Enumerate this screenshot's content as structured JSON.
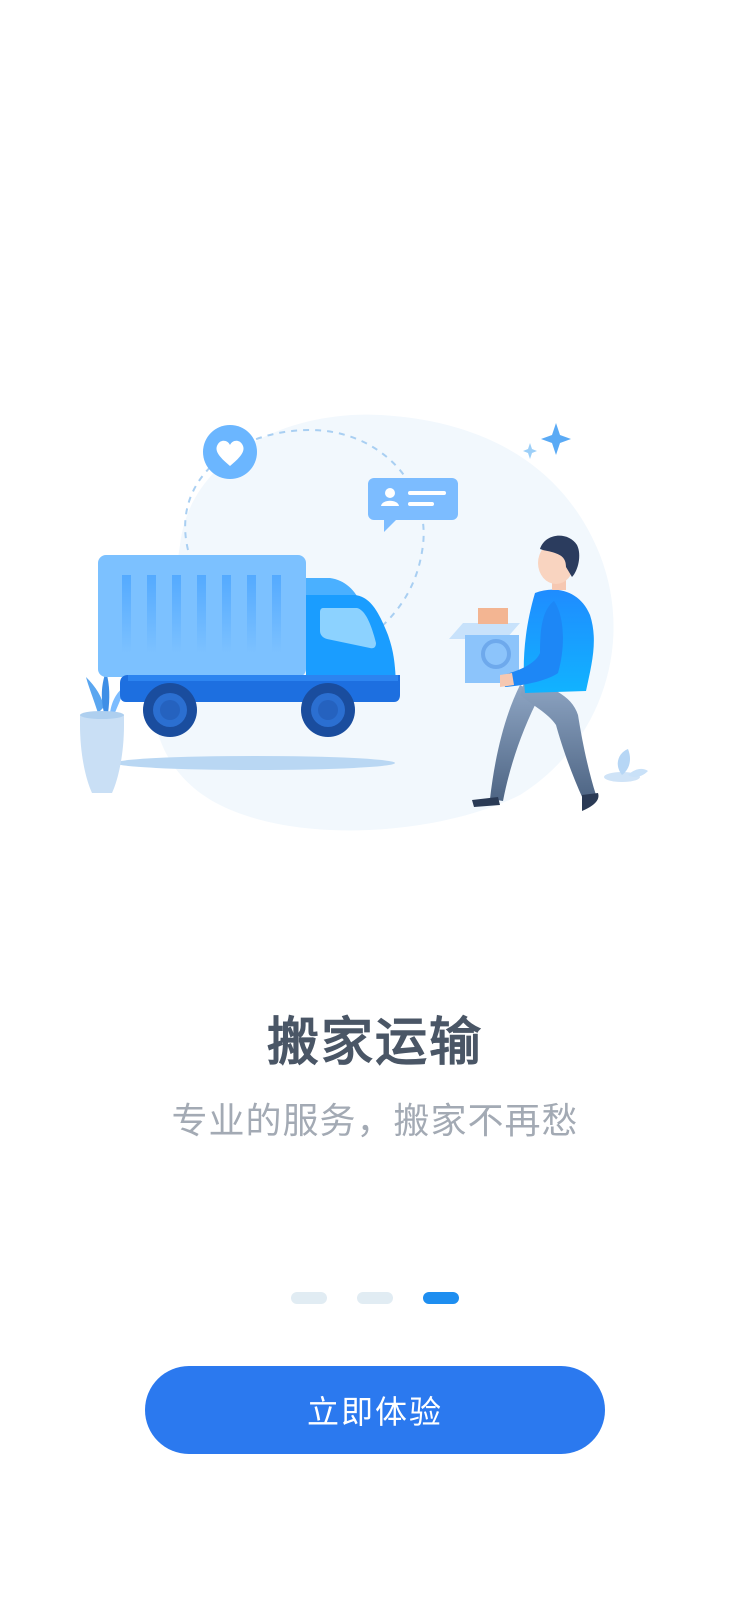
{
  "onboarding": {
    "title": "搬家运输",
    "subtitle": "专业的服务，搬家不再愁",
    "pager": {
      "total": 3,
      "active_index": 2
    },
    "cta_label": "立即体验"
  },
  "colors": {
    "primary": "#2b79ef",
    "title": "#4a5666",
    "subtitle": "#a3aab4",
    "dot_inactive": "#e1ecf3",
    "dot_active": "#1e8ef0"
  },
  "illustration": {
    "icons": [
      "truck-icon",
      "person-carrying-box-icon",
      "heart-icon",
      "chat-bubble-icon",
      "plant-pot-icon",
      "sparkle-icon"
    ]
  }
}
